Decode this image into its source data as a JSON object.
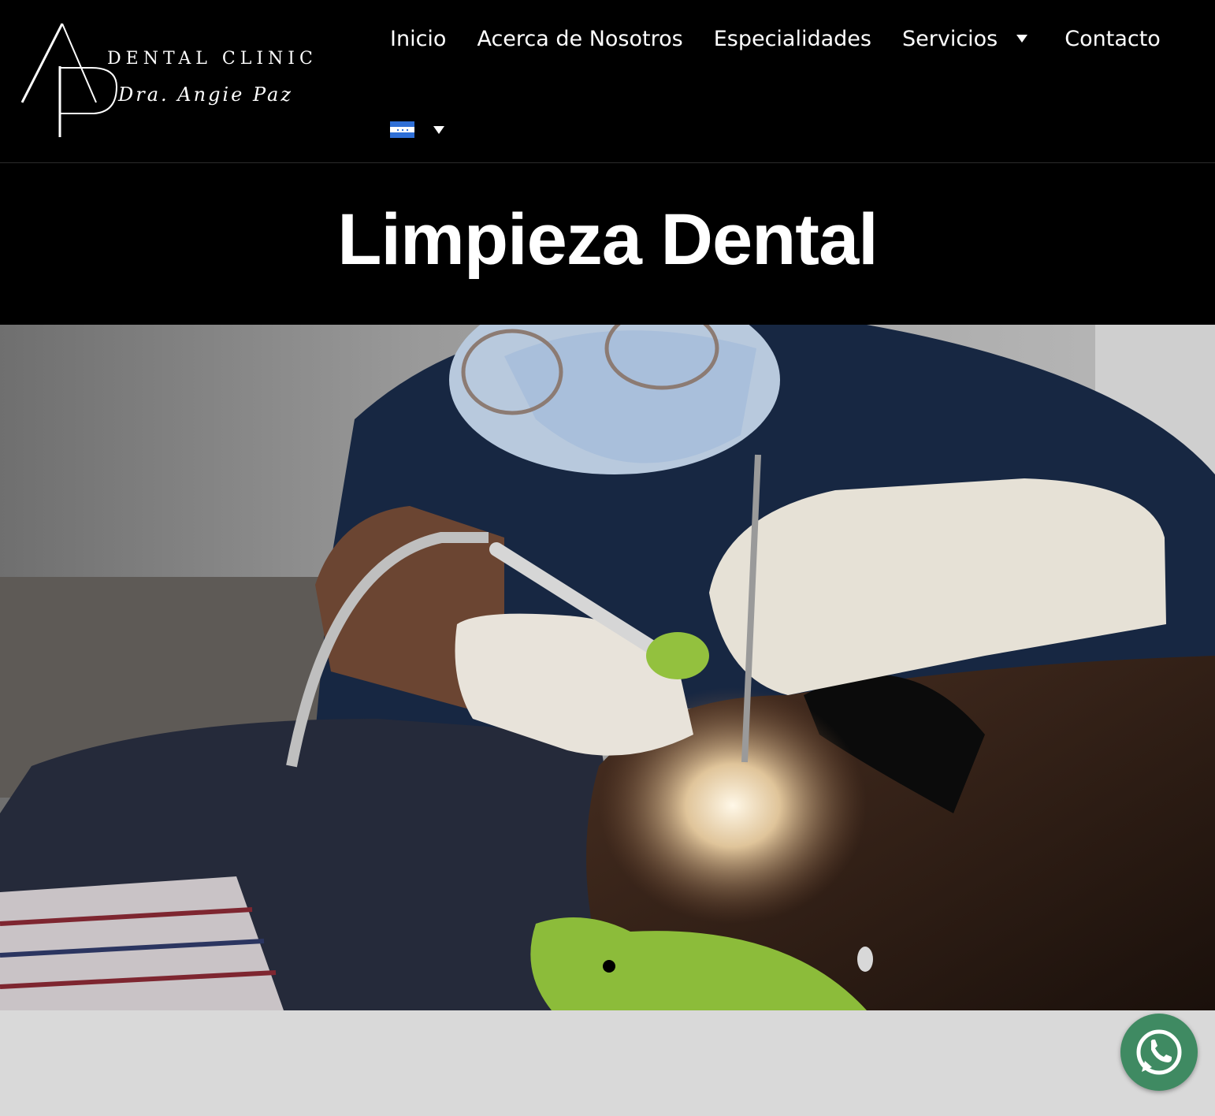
{
  "header": {
    "logo": {
      "line1": "DENTAL CLINIC",
      "line2": "Dra. Angie Paz"
    },
    "nav": {
      "items": [
        {
          "label": "Inicio",
          "has_dropdown": false
        },
        {
          "label": "Acerca de Nosotros",
          "has_dropdown": false
        },
        {
          "label": "Especialidades",
          "has_dropdown": false
        },
        {
          "label": "Servicios",
          "has_dropdown": true
        },
        {
          "label": "Contacto",
          "has_dropdown": false
        }
      ]
    },
    "language": {
      "flag_icon": "honduras-flag-icon",
      "has_dropdown": true
    }
  },
  "page": {
    "title": "Limpieza Dental"
  },
  "hero": {
    "image": "dentist-cleaning-patient-teeth-photo",
    "slider": {
      "total_slides": 1,
      "active_slide": 1
    }
  },
  "floating": {
    "whatsapp_icon": "whatsapp-icon",
    "whatsapp_color": "#3f8a62"
  },
  "colors": {
    "background": "#000000",
    "text": "#ffffff",
    "footer_band": "#d9d9d9"
  }
}
